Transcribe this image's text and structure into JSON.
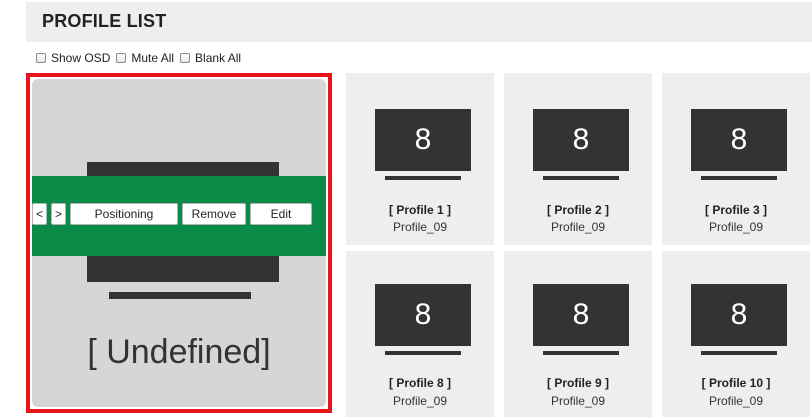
{
  "header": {
    "title": "PROFILE LIST"
  },
  "options": [
    {
      "label": "Show OSD",
      "checked": false
    },
    {
      "label": "Mute All",
      "checked": false
    },
    {
      "label": "Blank All",
      "checked": false
    }
  ],
  "selected": {
    "name": "[ Undefined]",
    "controls": {
      "prev": "<",
      "next": ">",
      "positioning": "Positioning",
      "remove": "Remove",
      "edit": "Edit"
    },
    "accent_color": "#0a8b47",
    "border_color": "#e8141c"
  },
  "profiles": [
    {
      "title": "[ Profile 1 ]",
      "subtitle": "Profile_09",
      "display": "8"
    },
    {
      "title": "[ Profile 2 ]",
      "subtitle": "Profile_09",
      "display": "8"
    },
    {
      "title": "[ Profile 3 ]",
      "subtitle": "Profile_09",
      "display": "8"
    },
    {
      "title": "[ Profile 8 ]",
      "subtitle": "Profile_09",
      "display": "8"
    },
    {
      "title": "[ Profile 9 ]",
      "subtitle": "Profile_09",
      "display": "8"
    },
    {
      "title": "[ Profile 10 ]",
      "subtitle": "Profile_09",
      "display": "8"
    }
  ]
}
